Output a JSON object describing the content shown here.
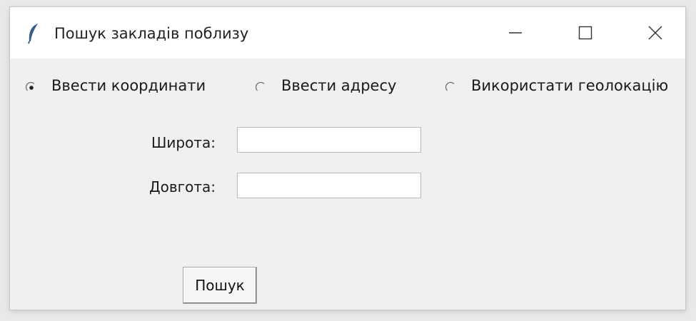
{
  "window": {
    "title": "Пошук закладів поблизу",
    "icon": "feather-icon",
    "controls": [
      "minimize-icon",
      "maximize-icon",
      "close-icon"
    ]
  },
  "mode": {
    "options": [
      {
        "label": "Ввести координати",
        "selected": true
      },
      {
        "label": "Ввести адресу",
        "selected": false
      },
      {
        "label": "Використати геолокацію",
        "selected": false
      }
    ]
  },
  "fields": {
    "latitude": {
      "label": "Широта:",
      "value": ""
    },
    "longitude": {
      "label": "Довгота:",
      "value": ""
    }
  },
  "actions": {
    "search_label": "Пошук"
  },
  "colors": {
    "titlebar": "#ffffff",
    "background": "#f0f0f0",
    "icon": "#3b5b8c"
  }
}
